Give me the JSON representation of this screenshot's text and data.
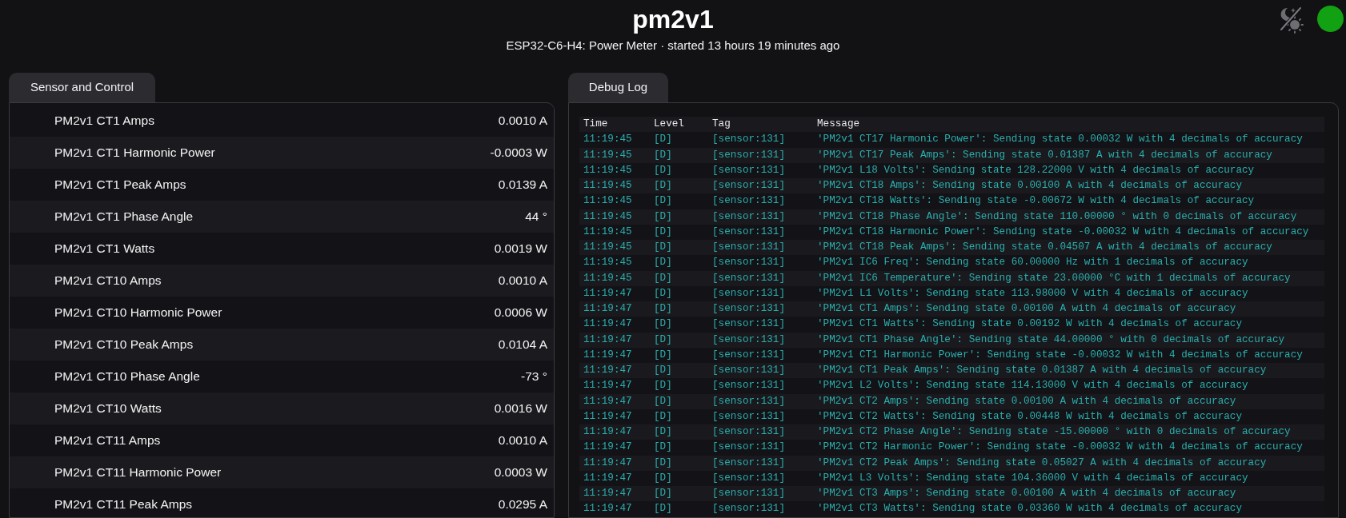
{
  "header": {
    "title": "pm2v1",
    "subtitle": "ESP32-C6-H4: Power Meter · started 13 hours 19 minutes ago",
    "connected": true
  },
  "sensor_panel": {
    "tab": "Sensor and Control",
    "rows": [
      {
        "name": "PM2v1 CT1 Amps",
        "value": "0.0010 A"
      },
      {
        "name": "PM2v1 CT1 Harmonic Power",
        "value": "-0.0003 W"
      },
      {
        "name": "PM2v1 CT1 Peak Amps",
        "value": "0.0139 A"
      },
      {
        "name": "PM2v1 CT1 Phase Angle",
        "value": "44 °"
      },
      {
        "name": "PM2v1 CT1 Watts",
        "value": "0.0019 W"
      },
      {
        "name": "PM2v1 CT10 Amps",
        "value": "0.0010 A"
      },
      {
        "name": "PM2v1 CT10 Harmonic Power",
        "value": "0.0006 W"
      },
      {
        "name": "PM2v1 CT10 Peak Amps",
        "value": "0.0104 A"
      },
      {
        "name": "PM2v1 CT10 Phase Angle",
        "value": "-73 °"
      },
      {
        "name": "PM2v1 CT10 Watts",
        "value": "0.0016 W"
      },
      {
        "name": "PM2v1 CT11 Amps",
        "value": "0.0010 A"
      },
      {
        "name": "PM2v1 CT11 Harmonic Power",
        "value": "0.0003 W"
      },
      {
        "name": "PM2v1 CT11 Peak Amps",
        "value": "0.0295 A"
      }
    ]
  },
  "log_panel": {
    "tab": "Debug Log",
    "columns": [
      "Time",
      "Level",
      "Tag",
      "Message"
    ],
    "rows": [
      {
        "time": "11:19:45",
        "level": "[D]",
        "tag": "[sensor:131]",
        "message": "'PM2v1 CT17 Harmonic Power': Sending state 0.00032 W with 4 decimals of accuracy"
      },
      {
        "time": "11:19:45",
        "level": "[D]",
        "tag": "[sensor:131]",
        "message": "'PM2v1 CT17 Peak Amps': Sending state 0.01387 A with 4 decimals of accuracy"
      },
      {
        "time": "11:19:45",
        "level": "[D]",
        "tag": "[sensor:131]",
        "message": "'PM2v1 L18 Volts': Sending state 128.22000 V with 4 decimals of accuracy"
      },
      {
        "time": "11:19:45",
        "level": "[D]",
        "tag": "[sensor:131]",
        "message": "'PM2v1 CT18 Amps': Sending state 0.00100 A with 4 decimals of accuracy"
      },
      {
        "time": "11:19:45",
        "level": "[D]",
        "tag": "[sensor:131]",
        "message": "'PM2v1 CT18 Watts': Sending state -0.00672 W with 4 decimals of accuracy"
      },
      {
        "time": "11:19:45",
        "level": "[D]",
        "tag": "[sensor:131]",
        "message": "'PM2v1 CT18 Phase Angle': Sending state 110.00000 ° with 0 decimals of accuracy"
      },
      {
        "time": "11:19:45",
        "level": "[D]",
        "tag": "[sensor:131]",
        "message": "'PM2v1 CT18 Harmonic Power': Sending state -0.00032 W with 4 decimals of accuracy"
      },
      {
        "time": "11:19:45",
        "level": "[D]",
        "tag": "[sensor:131]",
        "message": "'PM2v1 CT18 Peak Amps': Sending state 0.04507 A with 4 decimals of accuracy"
      },
      {
        "time": "11:19:45",
        "level": "[D]",
        "tag": "[sensor:131]",
        "message": "'PM2v1 IC6 Freq': Sending state 60.00000 Hz with 1 decimals of accuracy"
      },
      {
        "time": "11:19:45",
        "level": "[D]",
        "tag": "[sensor:131]",
        "message": "'PM2v1 IC6 Temperature': Sending state 23.00000 °C with 1 decimals of accuracy"
      },
      {
        "time": "11:19:47",
        "level": "[D]",
        "tag": "[sensor:131]",
        "message": "'PM2v1 L1 Volts': Sending state 113.98000 V with 4 decimals of accuracy"
      },
      {
        "time": "11:19:47",
        "level": "[D]",
        "tag": "[sensor:131]",
        "message": "'PM2v1 CT1 Amps': Sending state 0.00100 A with 4 decimals of accuracy"
      },
      {
        "time": "11:19:47",
        "level": "[D]",
        "tag": "[sensor:131]",
        "message": "'PM2v1 CT1 Watts': Sending state 0.00192 W with 4 decimals of accuracy"
      },
      {
        "time": "11:19:47",
        "level": "[D]",
        "tag": "[sensor:131]",
        "message": "'PM2v1 CT1 Phase Angle': Sending state 44.00000 ° with 0 decimals of accuracy"
      },
      {
        "time": "11:19:47",
        "level": "[D]",
        "tag": "[sensor:131]",
        "message": "'PM2v1 CT1 Harmonic Power': Sending state -0.00032 W with 4 decimals of accuracy"
      },
      {
        "time": "11:19:47",
        "level": "[D]",
        "tag": "[sensor:131]",
        "message": "'PM2v1 CT1 Peak Amps': Sending state 0.01387 A with 4 decimals of accuracy"
      },
      {
        "time": "11:19:47",
        "level": "[D]",
        "tag": "[sensor:131]",
        "message": "'PM2v1 L2 Volts': Sending state 114.13000 V with 4 decimals of accuracy"
      },
      {
        "time": "11:19:47",
        "level": "[D]",
        "tag": "[sensor:131]",
        "message": "'PM2v1 CT2 Amps': Sending state 0.00100 A with 4 decimals of accuracy"
      },
      {
        "time": "11:19:47",
        "level": "[D]",
        "tag": "[sensor:131]",
        "message": "'PM2v1 CT2 Watts': Sending state 0.00448 W with 4 decimals of accuracy"
      },
      {
        "time": "11:19:47",
        "level": "[D]",
        "tag": "[sensor:131]",
        "message": "'PM2v1 CT2 Phase Angle': Sending state -15.00000 ° with 0 decimals of accuracy"
      },
      {
        "time": "11:19:47",
        "level": "[D]",
        "tag": "[sensor:131]",
        "message": "'PM2v1 CT2 Harmonic Power': Sending state -0.00032 W with 4 decimals of accuracy"
      },
      {
        "time": "11:19:47",
        "level": "[D]",
        "tag": "[sensor:131]",
        "message": "'PM2v1 CT2 Peak Amps': Sending state 0.05027 A with 4 decimals of accuracy"
      },
      {
        "time": "11:19:47",
        "level": "[D]",
        "tag": "[sensor:131]",
        "message": "'PM2v1 L3 Volts': Sending state 104.36000 V with 4 decimals of accuracy"
      },
      {
        "time": "11:19:47",
        "level": "[D]",
        "tag": "[sensor:131]",
        "message": "'PM2v1 CT3 Amps': Sending state 0.00100 A with 4 decimals of accuracy"
      },
      {
        "time": "11:19:47",
        "level": "[D]",
        "tag": "[sensor:131]",
        "message": "'PM2v1 CT3 Watts': Sending state 0.03360 W with 4 decimals of accuracy"
      }
    ]
  }
}
